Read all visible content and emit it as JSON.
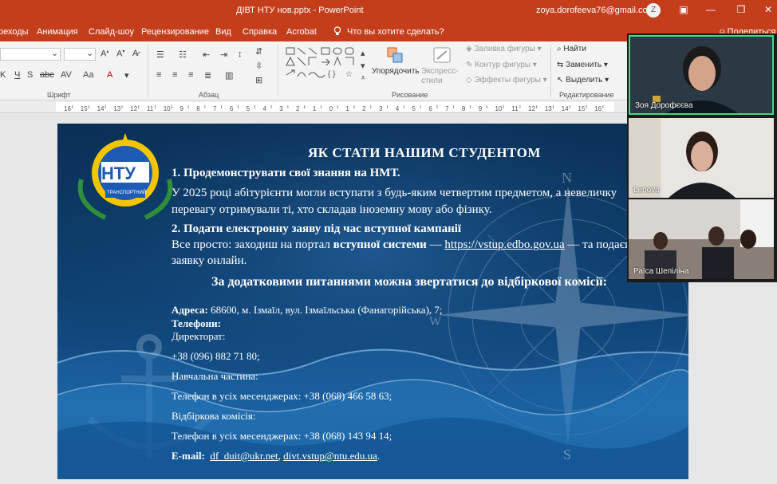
{
  "titlebar": {
    "document": "ДІВТ НТУ нов.pptx - PowerPoint",
    "email": "zoya.dorofeeva76@gmail.com",
    "avatar_letter": "Z"
  },
  "menu": {
    "items": [
      "реходы",
      "Анимация",
      "Слайд-шоу",
      "Рецензирование",
      "Вид",
      "Справка",
      "Acrobat"
    ],
    "tell_me": "Что вы хотите сделать?",
    "share": "Поделиться"
  },
  "ribbon": {
    "groups": {
      "font": "Шрифт",
      "paragraph": "Абзац",
      "drawing": "Рисование",
      "editing": "Редактирование"
    },
    "arrange": "Упорядочить",
    "quick_styles": "Экспресс-стили",
    "shape_fill": "Заливка фигуры",
    "shape_outline": "Контур фигуры",
    "shape_effects": "Эффекты фигуры",
    "find": "Найти",
    "replace": "Заменить",
    "select": "Выделить"
  },
  "ruler": {
    "ticks": [
      "16",
      "15",
      "14",
      "13",
      "12",
      "11",
      "10",
      "9",
      "8",
      "7",
      "6",
      "5",
      "4",
      "3",
      "2",
      "1",
      "0",
      "1",
      "2",
      "3",
      "4",
      "5",
      "6",
      "7",
      "8",
      "9",
      "10",
      "11",
      "12",
      "13",
      "14",
      "15",
      "16"
    ]
  },
  "slide": {
    "logo_text": "НТУ",
    "logo_ribbon": "ТРАНСПОРТНИЙ",
    "title": "ЯК СТАТИ НАШИМ СТУДЕНТОМ",
    "step1_heading": "1. Продемонструвати свої знання на НМТ.",
    "step1_line1": "У 2025 році абітурієнти могли вступати з будь-яким четвертим предметом, а невеличку",
    "step1_line2": "перевагу отримували ті, хто складав іноземну мову або фізику.",
    "step2_heading": "2. Подати електронну заяву під час вступної кампанії",
    "step2_pre": "Все просто: заходиш на портал ",
    "step2_bold": "вступної системи",
    "step2_dash": " — ",
    "step2_link": "https://vstup.edbo.gov.ua",
    "step2_post": " — та подаєш",
    "step2_line2": "заявку онлайн.",
    "contact_heading": "За додатковими питаннями можна звертатися до відбіркової комісії:",
    "address_label": "Адреса:",
    "address_value": " 68600, м. Ізмаїл, вул. Ізмаїльська (Фанагорійська), 7;",
    "phones_label": "Телефони:",
    "director_label": "Директорат:",
    "director_phone": "+38 (096) 882 71 80;",
    "academic_label": "Навчальна частина:",
    "academic_phone": "Телефон в усіх месенджерах: +38 (068) 466 58 63;",
    "admission_label": "Відбіркова комісія:",
    "admission_phone": "Телефон в усіх месенджерах: +38 (068) 143 94 14;",
    "email_label": "E-mail:",
    "email1": "df_duit@ukr.net",
    "email_sep": ", ",
    "email2": "divt.vstup@ntu.edu.ua",
    "email_end": ".",
    "compass": {
      "n": "N",
      "w": "W",
      "s": "S"
    }
  },
  "participants": [
    {
      "name": "Зоя Дорофєєва",
      "active": true
    },
    {
      "name": "Lenovo",
      "active": false
    },
    {
      "name": "Раїса Шепіліна",
      "active": false
    }
  ],
  "colors": {
    "powerpoint_red": "#c43e1c",
    "slide_blue": "#0d3d6b",
    "active_speaker": "#3ddc84"
  }
}
